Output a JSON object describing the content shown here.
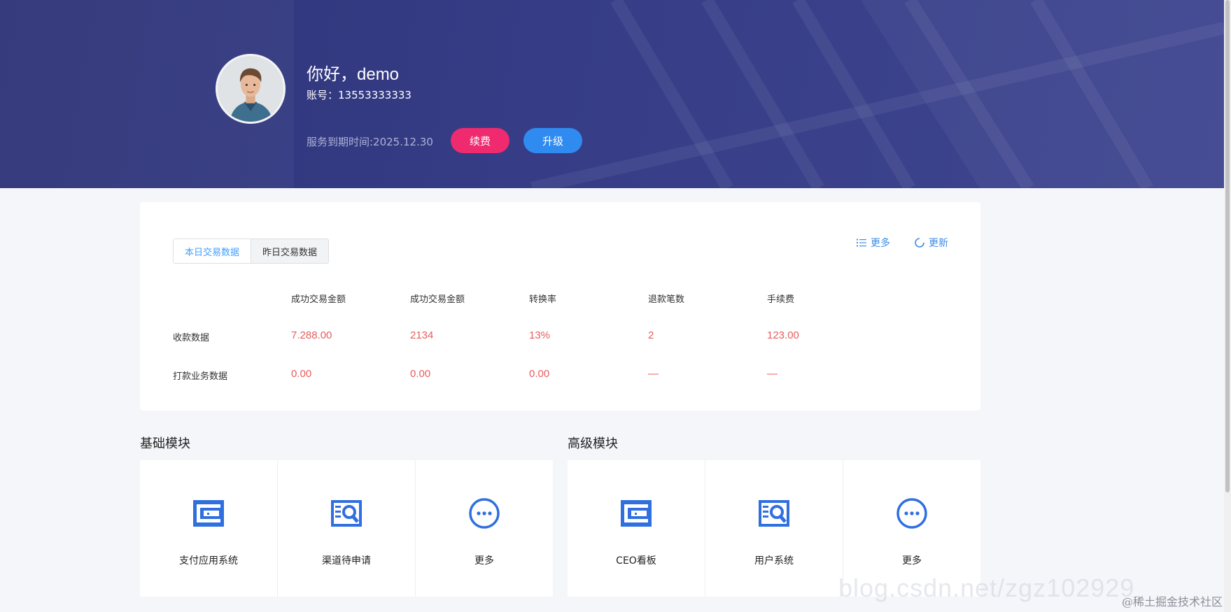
{
  "header": {
    "greeting": "你好，demo",
    "account": "账号：13553333333",
    "expire": "服务到期时间:2025.12.30",
    "renew_label": "续费",
    "upgrade_label": "升级"
  },
  "stats": {
    "tabs": [
      "本日交易数据",
      "昨日交易数据"
    ],
    "active_tab": "本日交易数据",
    "actions": {
      "more": "更多",
      "refresh": "更新"
    },
    "columns": [
      "成功交易金额",
      "成功交易金额",
      "转换率",
      "退款笔数",
      "手续费"
    ],
    "rows": [
      {
        "label": "收款数据",
        "values": [
          "7.288.00",
          "2134",
          "13%",
          "2",
          "123.00"
        ]
      },
      {
        "label": "打款业务数据",
        "values": [
          "0.00",
          "0.00",
          "0.00",
          "—",
          "—"
        ]
      }
    ]
  },
  "basic_modules": {
    "title": "基础模块",
    "items": [
      {
        "label": "支付应用系统",
        "icon": "card-icon"
      },
      {
        "label": "渠道待申请",
        "icon": "search-doc-icon"
      },
      {
        "label": "更多",
        "icon": "more-icon"
      }
    ]
  },
  "advanced_modules": {
    "title": "高级模块",
    "items": [
      {
        "label": "CEO看板",
        "icon": "card-icon"
      },
      {
        "label": "用户系统",
        "icon": "search-doc-icon"
      },
      {
        "label": "更多",
        "icon": "more-icon"
      }
    ]
  },
  "watermark": "blog.csdn.net/zgz102929",
  "corner_mark": "@稀土掘金技术社区",
  "colors": {
    "banner": "#353b84",
    "renew": "#ef2a6f",
    "upgrade": "#2f8bf0",
    "value_red": "#e85d5d",
    "accent_blue": "#3b8ee8"
  }
}
